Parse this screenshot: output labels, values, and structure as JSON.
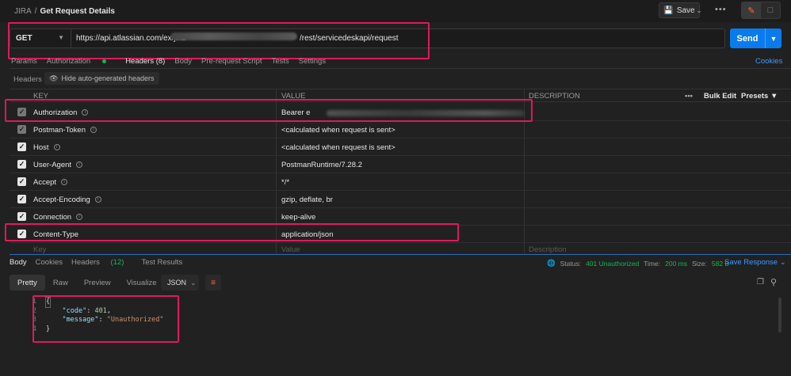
{
  "breadcrumb": {
    "collection": "JIRA",
    "separator": "/",
    "request": "Get Request Details"
  },
  "toolbar": {
    "save_label": "Save",
    "more": "•••"
  },
  "request": {
    "method": "GET",
    "url_prefix": "https://api.atlassian.com/ex/jira/",
    "url_suffix": "/rest/servicedeskapi/request",
    "send_label": "Send"
  },
  "request_tabs": [
    {
      "label": "Params"
    },
    {
      "label": "Authorization"
    },
    {
      "label": "Headers (8)"
    },
    {
      "label": "Body"
    },
    {
      "label": "Pre-request Script"
    },
    {
      "label": "Tests"
    },
    {
      "label": "Settings"
    }
  ],
  "cookies_link": "Cookies",
  "headers_section": {
    "label": "Headers",
    "hide_auto": "Hide auto-generated headers"
  },
  "table": {
    "columns": {
      "key": "KEY",
      "value": "VALUE",
      "description": "DESCRIPTION",
      "bulk_edit": "Bulk Edit",
      "presets": "Presets"
    },
    "rows": [
      {
        "key": "Authorization",
        "value": "Bearer e"
      },
      {
        "key": "Postman-Token",
        "value": "<calculated when request is sent>"
      },
      {
        "key": "Host",
        "value": "<calculated when request is sent>"
      },
      {
        "key": "User-Agent",
        "value": "PostmanRuntime/7.28.2"
      },
      {
        "key": "Accept",
        "value": "*/*"
      },
      {
        "key": "Accept-Encoding",
        "value": "gzip, deflate, br"
      },
      {
        "key": "Connection",
        "value": "keep-alive"
      },
      {
        "key": "Content-Type",
        "value": "application/json"
      }
    ],
    "placeholder": {
      "key": "Key",
      "value": "Value",
      "description": "Description"
    }
  },
  "response": {
    "tabs": [
      {
        "label": "Body"
      },
      {
        "label": "Cookies"
      },
      {
        "label": "Headers",
        "count": "(12)"
      },
      {
        "label": "Test Results"
      }
    ],
    "status_label": "Status:",
    "status_value": "401 Unauthorized",
    "time_label": "Time:",
    "time_value": "200 ms",
    "size_label": "Size:",
    "size_value": "582 B",
    "save_response": "Save Response",
    "formats": [
      "Pretty",
      "Raw",
      "Preview",
      "Visualize"
    ],
    "format_select": "JSON",
    "code_lines": [
      "{",
      "    \"code\": 401,",
      "    \"message\": \"Unauthorized\"",
      "}"
    ],
    "line_numbers": [
      "1",
      "2",
      "3",
      "4"
    ]
  },
  "colors": {
    "accent": "#ff6c37",
    "send": "#097bed",
    "highlight": "#e0195a",
    "success": "#0cbb52",
    "link": "#3b9aff"
  }
}
